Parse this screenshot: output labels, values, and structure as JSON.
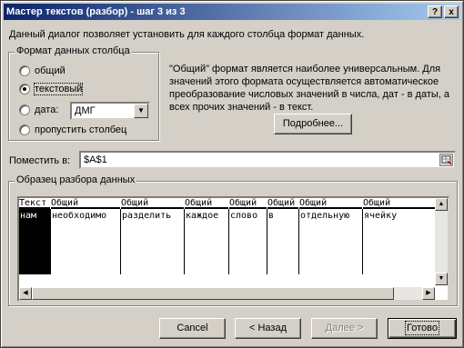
{
  "window": {
    "title": "Мастер текстов (разбор) - шаг 3 из 3",
    "help_glyph": "?",
    "close_glyph": "x"
  },
  "description": "Данный диалог позволяет установить для каждого столбца формат данных.",
  "format_group": {
    "legend": "Формат данных столбца",
    "options": [
      {
        "label": "общий",
        "checked": false
      },
      {
        "label": "текстовый",
        "checked": true
      },
      {
        "label": "дата:",
        "checked": false
      },
      {
        "label": "пропустить столбец",
        "checked": false
      }
    ],
    "date_format": "ДМГ"
  },
  "info_text": "\"Общий\" формат является наиболее универсальным. Для значений этого формата осуществляется автоматическое преобразование числовых значений в числа, дат - в даты, а всех прочих значений - в текст.",
  "more_button": "Подробнее...",
  "destination": {
    "label": "Поместить в:",
    "value": "$A$1"
  },
  "sample": {
    "legend": "Образец разбора данных",
    "columns": [
      {
        "header": "Текст",
        "value": "нам"
      },
      {
        "header": "Общий",
        "value": "необходимо"
      },
      {
        "header": "Общий",
        "value": "разделить"
      },
      {
        "header": "Общий",
        "value": "каждое"
      },
      {
        "header": "Общий",
        "value": "слово"
      },
      {
        "header": "Общий",
        "value": "в"
      },
      {
        "header": "Общий",
        "value": "отдельную"
      },
      {
        "header": "Общий",
        "value": "ячейку"
      }
    ]
  },
  "buttons": {
    "cancel": "Cancel",
    "back": "< Назад",
    "next": "Далее >",
    "finish": "Готово"
  }
}
